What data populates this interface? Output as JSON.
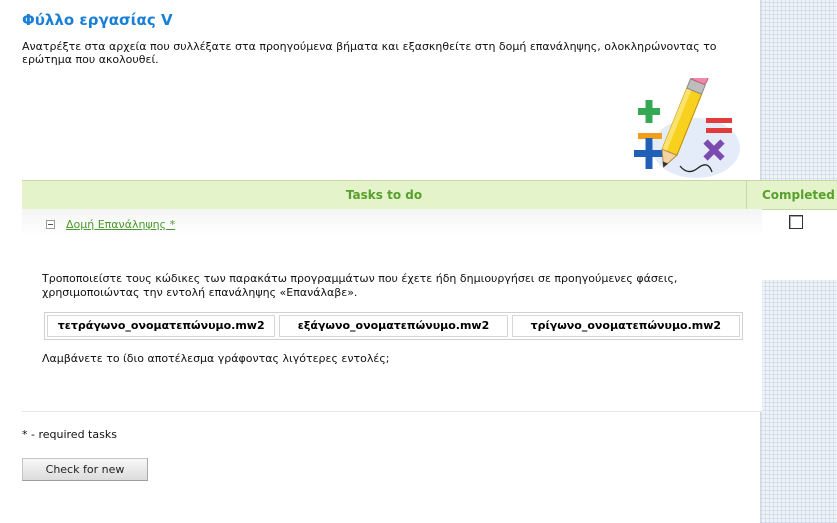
{
  "page": {
    "title": "Φύλλο εργασίας V",
    "intro": "Ανατρέξτε στα αρχεία που συλλέξατε στα προηγούμενα βήματα και εξασκηθείτε στη δομή επανάληψης, ολοκληρώνοντας το ερώτημα που ακολουθεί."
  },
  "table": {
    "headers": {
      "tasks": "Tasks to do",
      "completed": "Completed"
    },
    "task": {
      "title": "Δομή Επανάληψης *",
      "completed": false,
      "description": "Τροποποιείστε τους κώδικες των παρακάτω προγραμμάτων που έχετε ήδη δημιουργήσει σε προηγούμενες φάσεις, χρησιμοποιώντας την εντολή επανάληψης «Επανάλαβε».",
      "files": [
        "τετράγωνο_ονοματεπώνυμο.mw2",
        "εξάγωνο_ονοματεπώνυμο.mw2",
        "τρίγωνο_ονοματεπώνυμο.mw2"
      ],
      "question": "Λαμβάνετε το ίδιο αποτέλεσμα γράφοντας λιγότερες εντολές;"
    }
  },
  "footer": {
    "required_note": "* - required tasks",
    "check_button": "Check for new"
  },
  "colors": {
    "title": "#1a7fd6",
    "header_bg": "#e4f3c9",
    "header_text": "#58a02d",
    "link": "#4a9a2a"
  },
  "icons": {
    "illustration": "math-pencil-clipart",
    "collapse": "minus-box-icon"
  }
}
